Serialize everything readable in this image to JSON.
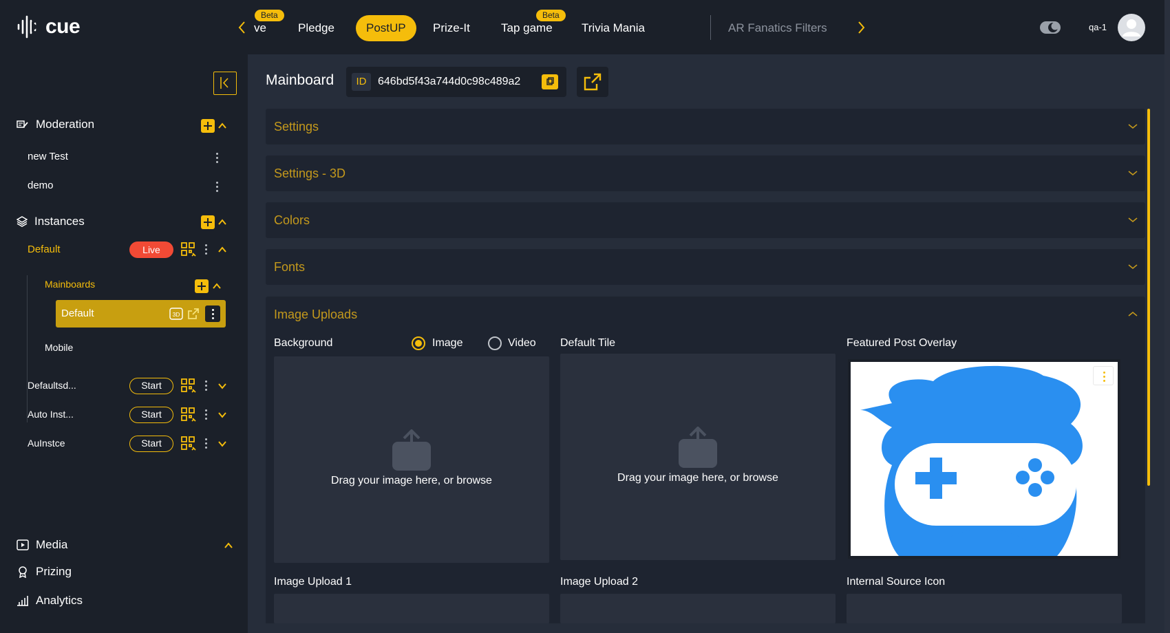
{
  "app": {
    "logo_text": "cue",
    "user_name": "qa-1"
  },
  "tabs": [
    {
      "label": "ve",
      "beta": "Beta"
    },
    {
      "label": "Pledge"
    },
    {
      "label": "PostUP",
      "active": true
    },
    {
      "label": "Prize-It"
    },
    {
      "label": "Tap game",
      "beta": "Beta"
    },
    {
      "label": "Trivia Mania"
    },
    {
      "label": "AR Fanatics Filters"
    }
  ],
  "sidebar": {
    "moderation": {
      "label": "Moderation",
      "items": [
        "new Test",
        "demo"
      ]
    },
    "instances": {
      "label": "Instances",
      "default_instance": {
        "label": "Default",
        "status": "Live"
      },
      "mainboards": {
        "label": "Mainboards",
        "items": [
          "Default",
          "Mobile"
        ],
        "selected_badge": "3D"
      },
      "others": [
        {
          "label": "Defaultsd...",
          "status": "Start"
        },
        {
          "label": "Auto Inst...",
          "status": "Start"
        },
        {
          "label": "AuInstce",
          "status": "Start"
        }
      ]
    },
    "bottom": {
      "media": "Media",
      "prizing": "Prizing",
      "analytics": "Analytics"
    }
  },
  "main": {
    "title": "Mainboard",
    "id_tag": "ID",
    "id_value": "646bd5f43a744d0c98c489a2",
    "accordions": [
      "Settings",
      "Settings - 3D",
      "Colors",
      "Fonts",
      "Image Uploads"
    ],
    "uploads": {
      "background_label": "Background",
      "radio_image": "Image",
      "radio_video": "Video",
      "default_tile_label": "Default Tile",
      "featured_label": "Featured Post Overlay",
      "drop_text": "Drag your image here, or browse",
      "upload1_label": "Image Upload 1",
      "upload2_label": "Image Upload 2",
      "internal_label": "Internal Source Icon"
    }
  },
  "colors": {
    "accent": "#f5bd0b",
    "live": "#f24a35",
    "background": "#1b2029",
    "panel": "#262d3a"
  }
}
